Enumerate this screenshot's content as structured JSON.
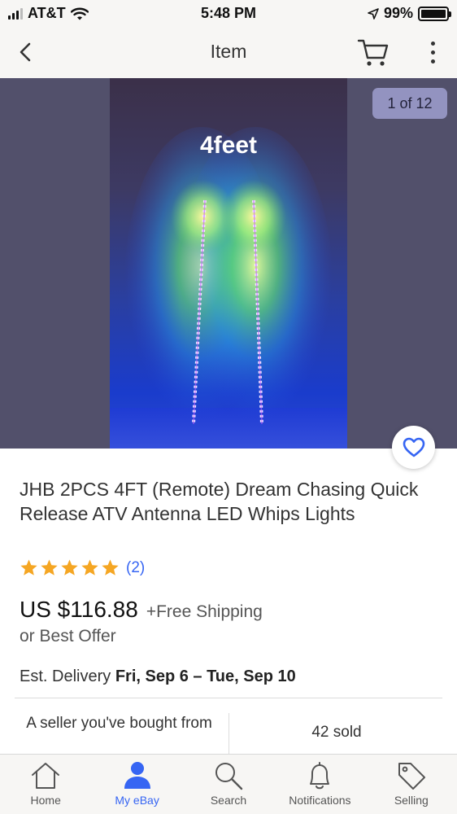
{
  "status_bar": {
    "carrier": "AT&T",
    "time": "5:48 PM",
    "battery": "99%"
  },
  "nav": {
    "title": "Item",
    "icons": [
      "chevron-left-icon",
      "cart-icon",
      "more-vertical-icon"
    ]
  },
  "gallery": {
    "caption": "4feet",
    "counter": "1 of 12"
  },
  "item": {
    "title": "JHB 2PCS 4FT (Remote) Dream Chasing Quick Release ATV Antenna LED Whips Lights",
    "rating_stars": 5,
    "rating_count": "(2)",
    "price": "US $116.88",
    "shipping": "+Free Shipping",
    "best_offer": "or Best Offer",
    "delivery_label": "Est. Delivery",
    "delivery_dates": "Fri, Sep 6 – Tue, Sep 10",
    "seller_note": "A seller you've bought from",
    "sold": "42 sold"
  },
  "tabs": [
    {
      "label": "Home",
      "icon": "home-icon",
      "active": false
    },
    {
      "label": "My eBay",
      "icon": "person-icon",
      "active": true
    },
    {
      "label": "Search",
      "icon": "search-icon",
      "active": false
    },
    {
      "label": "Notifications",
      "icon": "bell-icon",
      "active": false
    },
    {
      "label": "Selling",
      "icon": "tag-icon",
      "active": false
    }
  ],
  "colors": {
    "accent": "#3665f3",
    "star": "#f5a623",
    "bar_background": "#f7f6f4"
  }
}
